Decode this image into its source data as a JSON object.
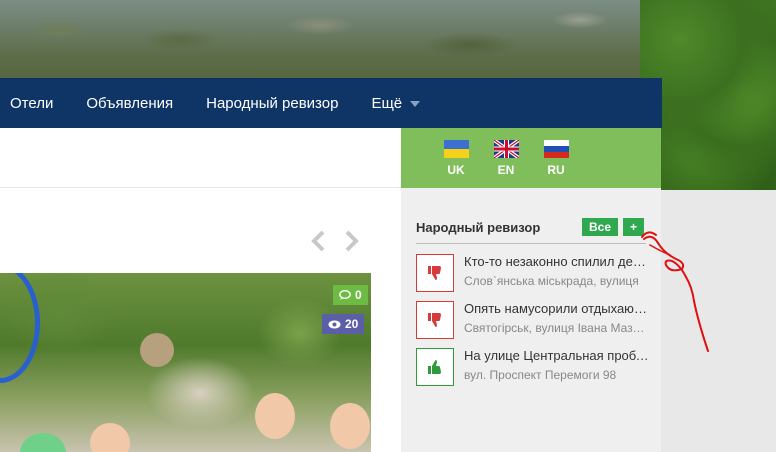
{
  "nav": {
    "items": [
      "Отели",
      "Объявления",
      "Народный ревизор"
    ],
    "more_label": "Ещё"
  },
  "languages": [
    {
      "code": "UK",
      "flag": "ukraine-flag"
    },
    {
      "code": "EN",
      "flag": "uk-flag"
    },
    {
      "code": "RU",
      "flag": "russia-flag"
    }
  ],
  "gallery": {
    "comments_count": "0",
    "views_count": "20"
  },
  "revisor": {
    "title": "Народный ревизор",
    "all_label": "Все",
    "add_label": "+",
    "items": [
      {
        "title": "Кто-то незаконно спилил дерево",
        "address": "Слов`янська міськрада, вулиця",
        "status": "negative"
      },
      {
        "title": "Опять намусорили отдыхающие",
        "address": "Святогірськ, вулиця Івана Мазепи",
        "status": "negative"
      },
      {
        "title": "На улице Центральная проблема",
        "address": "вул. Проспект Перемоги 98",
        "status": "positive"
      }
    ]
  },
  "colors": {
    "navbar": "#0f3466",
    "lang_bar": "#7fbe5b",
    "button_green": "#2fa84f",
    "negative": "#d63a3a",
    "positive": "#2f9a3a",
    "annotation": "#e01010"
  }
}
